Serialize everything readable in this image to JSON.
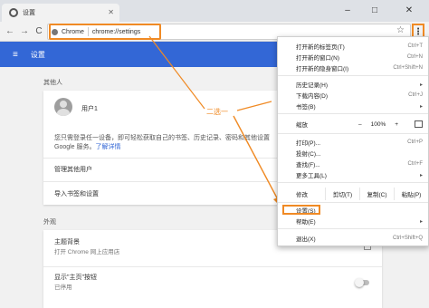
{
  "tab": {
    "title": "设置"
  },
  "window": {
    "minimize": "–",
    "maximize": "□",
    "close": "✕"
  },
  "toolbar": {
    "back": "←",
    "forward": "→",
    "reload": "C",
    "chip": "Chrome",
    "url": "chrome://settings",
    "star": "☆",
    "menu": "⋮"
  },
  "header": {
    "menu_icon": "≡",
    "title": "设置"
  },
  "people": {
    "section_label": "其他人",
    "user_name": "用户1",
    "desc_line1": "您只需登录任一设备，即可轻松获取自己的书签、历史记录、密码和其他设置",
    "desc_line2_prefix": "Google 服务。",
    "desc_link": "了解详情",
    "manage_label": "管理其他用户",
    "import_label": "导入书签和设置"
  },
  "appearance": {
    "section_label": "外观",
    "theme_label": "主题背景",
    "theme_sub": "打开 Chrome 网上应用店",
    "home_label": "显示\"主页\"按钮",
    "home_sub": "已停用"
  },
  "annotation": {
    "text": "二选一"
  },
  "menu": {
    "items": [
      {
        "label": "打开新的标签页(T)",
        "shortcut": "Ctrl+T"
      },
      {
        "label": "打开新的窗口(N)",
        "shortcut": "Ctrl+N"
      },
      {
        "label": "打开新的隐身窗口(I)",
        "shortcut": "Ctrl+Shift+N"
      },
      {
        "label": "历史记录(H)",
        "shortcut": "▸"
      },
      {
        "label": "下载内容(D)",
        "shortcut": "Ctrl+J"
      },
      {
        "label": "书签(B)",
        "shortcut": "▸"
      }
    ],
    "zoom": {
      "label": "缩放",
      "minus": "–",
      "value": "100%",
      "plus": "+"
    },
    "items2": [
      {
        "label": "打印(P)...",
        "shortcut": "Ctrl+P"
      },
      {
        "label": "投射(C)...",
        "shortcut": ""
      },
      {
        "label": "查找(F)...",
        "shortcut": "Ctrl+F"
      },
      {
        "label": "更多工具(L)",
        "shortcut": "▸"
      }
    ],
    "edit": {
      "label": "修改",
      "cut": "剪切(T)",
      "copy": "复制(C)",
      "paste": "粘贴(P)"
    },
    "items3": [
      {
        "label": "设置(S)",
        "shortcut": ""
      },
      {
        "label": "帮助(E)",
        "shortcut": "▸"
      }
    ],
    "exit": {
      "label": "退出(X)",
      "shortcut": "Ctrl+Shift+Q"
    }
  },
  "colors": {
    "accent": "#3367d6",
    "highlight": "#f08a24"
  }
}
